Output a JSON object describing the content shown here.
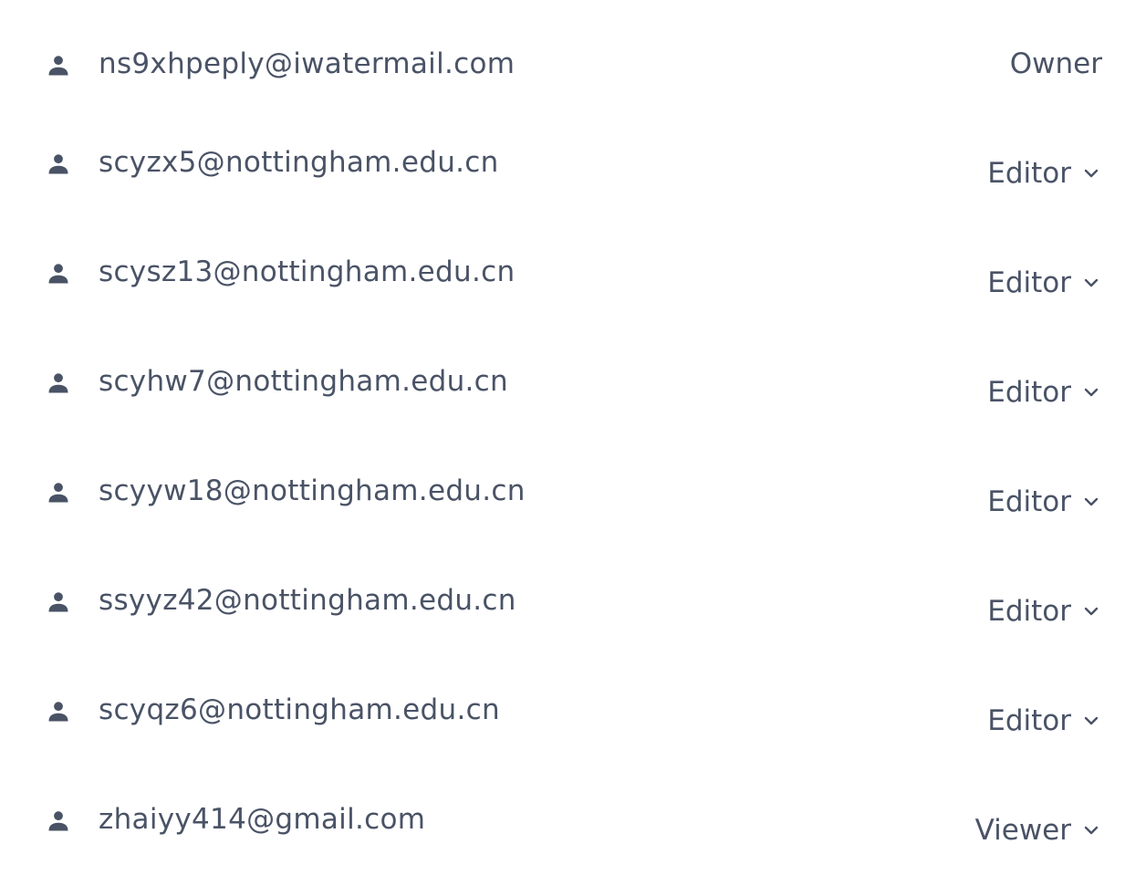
{
  "members": [
    {
      "email": "ns9xhpeply@iwatermail.com",
      "role": "Owner",
      "editable": false
    },
    {
      "email": "scyzx5@nottingham.edu.cn",
      "role": "Editor",
      "editable": true
    },
    {
      "email": "scysz13@nottingham.edu.cn",
      "role": "Editor",
      "editable": true
    },
    {
      "email": "scyhw7@nottingham.edu.cn",
      "role": "Editor",
      "editable": true
    },
    {
      "email": "scyyw18@nottingham.edu.cn",
      "role": "Editor",
      "editable": true
    },
    {
      "email": "ssyyz42@nottingham.edu.cn",
      "role": "Editor",
      "editable": true
    },
    {
      "email": "scyqz6@nottingham.edu.cn",
      "role": "Editor",
      "editable": true
    },
    {
      "email": "zhaiyy414@gmail.com",
      "role": "Viewer",
      "editable": true
    }
  ],
  "icons": {
    "member": "person-icon",
    "dropdown": "chevron-down-icon"
  },
  "colors": {
    "text": "#4a5366",
    "icon": "#495365",
    "background": "#ffffff"
  }
}
